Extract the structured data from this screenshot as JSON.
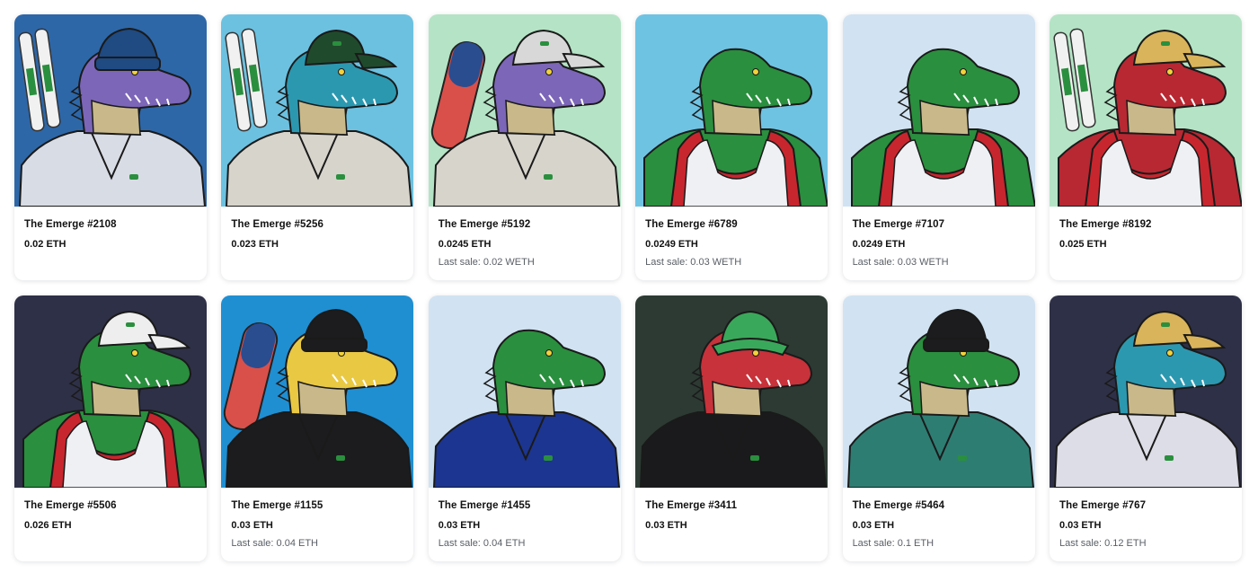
{
  "items": [
    {
      "name": "The Emerge #2108",
      "price": "0.02 ETH",
      "last_sale": "",
      "bg": "#2d67a8",
      "croc": "#7c66b8",
      "outfit": "#d8dce5",
      "hat": "beanie",
      "hat_color": "#1f4a82",
      "extra": "skis"
    },
    {
      "name": "The Emerge #5256",
      "price": "0.023 ETH",
      "last_sale": "",
      "bg": "#6cc1e0",
      "croc": "#2c98b0",
      "outfit": "#d7d4cc",
      "hat": "cap",
      "hat_color": "#204a2c",
      "extra": "skis"
    },
    {
      "name": "The Emerge #5192",
      "price": "0.0245 ETH",
      "last_sale": "Last sale: 0.02 WETH",
      "bg": "#b4e4c5",
      "croc": "#7c66b8",
      "outfit": "#d7d4cc",
      "hat": "cap",
      "hat_color": "#d8d8d8",
      "extra": "skateboard"
    },
    {
      "name": "The Emerge #6789",
      "price": "0.0249 ETH",
      "last_sale": "Last sale: 0.03 WETH",
      "bg": "#6fc3e2",
      "croc": "#2a8f3e",
      "outfit": "tank",
      "hat": "none",
      "hat_color": "",
      "extra": "none"
    },
    {
      "name": "The Emerge #7107",
      "price": "0.0249 ETH",
      "last_sale": "Last sale: 0.03 WETH",
      "bg": "#d1e3f2",
      "croc": "#2a8f3e",
      "outfit": "tank",
      "hat": "none",
      "hat_color": "",
      "extra": "none"
    },
    {
      "name": "The Emerge #8192",
      "price": "0.025 ETH",
      "last_sale": "",
      "bg": "#b4e4c5",
      "croc": "#b82832",
      "outfit": "tank",
      "hat": "cap",
      "hat_color": "#d9b45a",
      "extra": "skis"
    },
    {
      "name": "The Emerge #5506",
      "price": "0.026 ETH",
      "last_sale": "",
      "bg": "#2e3047",
      "croc": "#2a8f3e",
      "outfit": "tank",
      "hat": "cap",
      "hat_color": "#eeeeee",
      "extra": "none"
    },
    {
      "name": "The Emerge #1155",
      "price": "0.03 ETH",
      "last_sale": "Last sale: 0.04 ETH",
      "bg": "#1f8fd2",
      "croc": "#e9c843",
      "outfit": "#1c1c1e",
      "hat": "beanie",
      "hat_color": "#1c1c1e",
      "extra": "skateboard"
    },
    {
      "name": "The Emerge #1455",
      "price": "0.03 ETH",
      "last_sale": "Last sale: 0.04 ETH",
      "bg": "#d1e3f2",
      "croc": "#2a8f3e",
      "outfit": "#1c3590",
      "hat": "none",
      "hat_color": "",
      "extra": "none"
    },
    {
      "name": "The Emerge #3411",
      "price": "0.03 ETH",
      "last_sale": "",
      "bg": "#2c3a33",
      "croc": "#c8323a",
      "outfit": "#1a1a1c",
      "hat": "bucket",
      "hat_color": "#3aa85a",
      "extra": "none"
    },
    {
      "name": "The Emerge #5464",
      "price": "0.03 ETH",
      "last_sale": "Last sale: 0.1 ETH",
      "bg": "#d1e3f2",
      "croc": "#2a8f3e",
      "outfit": "#2e7d73",
      "hat": "beanie",
      "hat_color": "#1c1c1e",
      "extra": "none"
    },
    {
      "name": "The Emerge #767",
      "price": "0.03 ETH",
      "last_sale": "Last sale: 0.12 ETH",
      "bg": "#2e3047",
      "croc": "#2c98b0",
      "outfit": "#dcdde6",
      "hat": "cap",
      "hat_color": "#d9b45a",
      "extra": "none"
    }
  ]
}
